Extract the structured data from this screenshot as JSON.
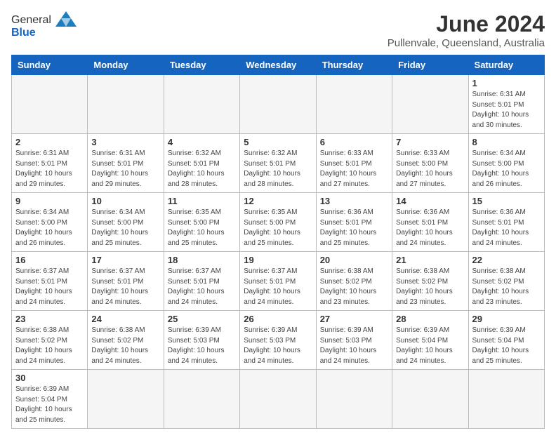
{
  "logo": {
    "text_general": "General",
    "text_blue": "Blue"
  },
  "title": "June 2024",
  "subtitle": "Pullenvale, Queensland, Australia",
  "days_of_week": [
    "Sunday",
    "Monday",
    "Tuesday",
    "Wednesday",
    "Thursday",
    "Friday",
    "Saturday"
  ],
  "weeks": [
    [
      {
        "day": "",
        "info": ""
      },
      {
        "day": "",
        "info": ""
      },
      {
        "day": "",
        "info": ""
      },
      {
        "day": "",
        "info": ""
      },
      {
        "day": "",
        "info": ""
      },
      {
        "day": "",
        "info": ""
      },
      {
        "day": "1",
        "info": "Sunrise: 6:31 AM\nSunset: 5:01 PM\nDaylight: 10 hours\nand 30 minutes."
      }
    ],
    [
      {
        "day": "2",
        "info": "Sunrise: 6:31 AM\nSunset: 5:01 PM\nDaylight: 10 hours\nand 29 minutes."
      },
      {
        "day": "3",
        "info": "Sunrise: 6:31 AM\nSunset: 5:01 PM\nDaylight: 10 hours\nand 29 minutes."
      },
      {
        "day": "4",
        "info": "Sunrise: 6:32 AM\nSunset: 5:01 PM\nDaylight: 10 hours\nand 28 minutes."
      },
      {
        "day": "5",
        "info": "Sunrise: 6:32 AM\nSunset: 5:01 PM\nDaylight: 10 hours\nand 28 minutes."
      },
      {
        "day": "6",
        "info": "Sunrise: 6:33 AM\nSunset: 5:01 PM\nDaylight: 10 hours\nand 27 minutes."
      },
      {
        "day": "7",
        "info": "Sunrise: 6:33 AM\nSunset: 5:00 PM\nDaylight: 10 hours\nand 27 minutes."
      },
      {
        "day": "8",
        "info": "Sunrise: 6:34 AM\nSunset: 5:00 PM\nDaylight: 10 hours\nand 26 minutes."
      }
    ],
    [
      {
        "day": "9",
        "info": "Sunrise: 6:34 AM\nSunset: 5:00 PM\nDaylight: 10 hours\nand 26 minutes."
      },
      {
        "day": "10",
        "info": "Sunrise: 6:34 AM\nSunset: 5:00 PM\nDaylight: 10 hours\nand 25 minutes."
      },
      {
        "day": "11",
        "info": "Sunrise: 6:35 AM\nSunset: 5:00 PM\nDaylight: 10 hours\nand 25 minutes."
      },
      {
        "day": "12",
        "info": "Sunrise: 6:35 AM\nSunset: 5:00 PM\nDaylight: 10 hours\nand 25 minutes."
      },
      {
        "day": "13",
        "info": "Sunrise: 6:36 AM\nSunset: 5:01 PM\nDaylight: 10 hours\nand 25 minutes."
      },
      {
        "day": "14",
        "info": "Sunrise: 6:36 AM\nSunset: 5:01 PM\nDaylight: 10 hours\nand 24 minutes."
      },
      {
        "day": "15",
        "info": "Sunrise: 6:36 AM\nSunset: 5:01 PM\nDaylight: 10 hours\nand 24 minutes."
      }
    ],
    [
      {
        "day": "16",
        "info": "Sunrise: 6:37 AM\nSunset: 5:01 PM\nDaylight: 10 hours\nand 24 minutes."
      },
      {
        "day": "17",
        "info": "Sunrise: 6:37 AM\nSunset: 5:01 PM\nDaylight: 10 hours\nand 24 minutes."
      },
      {
        "day": "18",
        "info": "Sunrise: 6:37 AM\nSunset: 5:01 PM\nDaylight: 10 hours\nand 24 minutes."
      },
      {
        "day": "19",
        "info": "Sunrise: 6:37 AM\nSunset: 5:01 PM\nDaylight: 10 hours\nand 24 minutes."
      },
      {
        "day": "20",
        "info": "Sunrise: 6:38 AM\nSunset: 5:02 PM\nDaylight: 10 hours\nand 23 minutes."
      },
      {
        "day": "21",
        "info": "Sunrise: 6:38 AM\nSunset: 5:02 PM\nDaylight: 10 hours\nand 23 minutes."
      },
      {
        "day": "22",
        "info": "Sunrise: 6:38 AM\nSunset: 5:02 PM\nDaylight: 10 hours\nand 23 minutes."
      }
    ],
    [
      {
        "day": "23",
        "info": "Sunrise: 6:38 AM\nSunset: 5:02 PM\nDaylight: 10 hours\nand 24 minutes."
      },
      {
        "day": "24",
        "info": "Sunrise: 6:38 AM\nSunset: 5:02 PM\nDaylight: 10 hours\nand 24 minutes."
      },
      {
        "day": "25",
        "info": "Sunrise: 6:39 AM\nSunset: 5:03 PM\nDaylight: 10 hours\nand 24 minutes."
      },
      {
        "day": "26",
        "info": "Sunrise: 6:39 AM\nSunset: 5:03 PM\nDaylight: 10 hours\nand 24 minutes."
      },
      {
        "day": "27",
        "info": "Sunrise: 6:39 AM\nSunset: 5:03 PM\nDaylight: 10 hours\nand 24 minutes."
      },
      {
        "day": "28",
        "info": "Sunrise: 6:39 AM\nSunset: 5:04 PM\nDaylight: 10 hours\nand 24 minutes."
      },
      {
        "day": "29",
        "info": "Sunrise: 6:39 AM\nSunset: 5:04 PM\nDaylight: 10 hours\nand 25 minutes."
      }
    ],
    [
      {
        "day": "30",
        "info": "Sunrise: 6:39 AM\nSunset: 5:04 PM\nDaylight: 10 hours\nand 25 minutes."
      },
      {
        "day": "",
        "info": ""
      },
      {
        "day": "",
        "info": ""
      },
      {
        "day": "",
        "info": ""
      },
      {
        "day": "",
        "info": ""
      },
      {
        "day": "",
        "info": ""
      },
      {
        "day": "",
        "info": ""
      }
    ]
  ]
}
